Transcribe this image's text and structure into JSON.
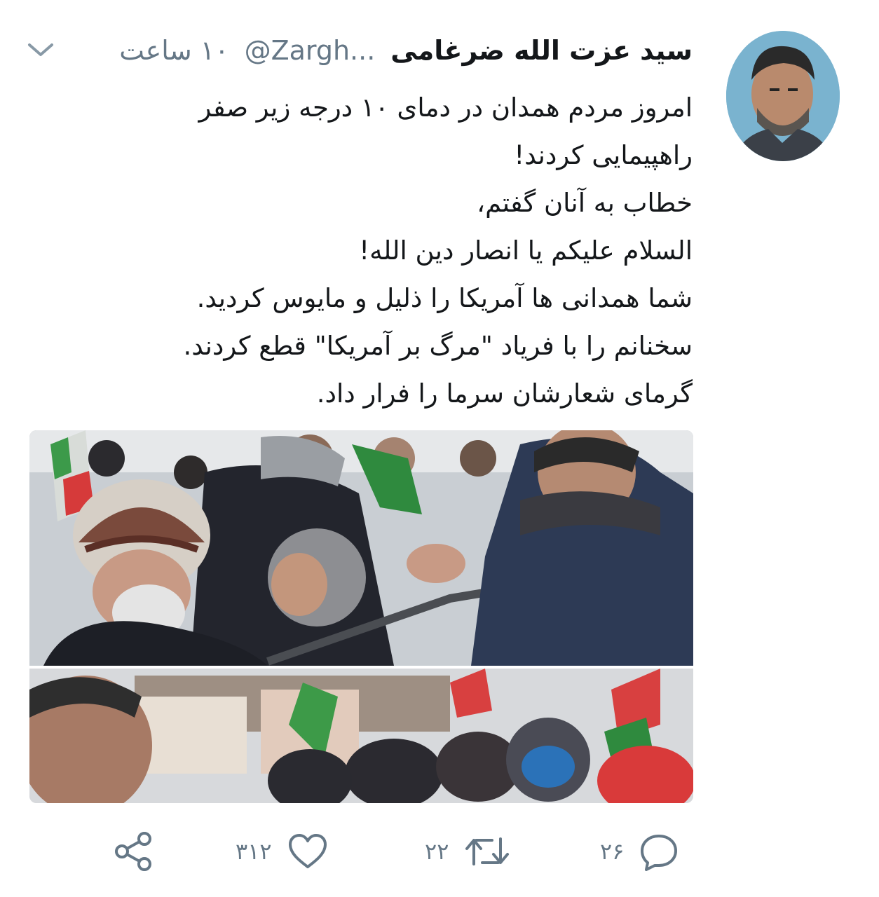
{
  "tweet": {
    "author_name": "سید عزت الله ضرغامی",
    "handle": "@Zargh...",
    "time": "۱۰ ساعت",
    "lines": [
      "امروز مردم همدان در دمای ۱۰ درجه زیر صفر",
      "راهپیمایی کردند!",
      "خطاب به آنان گفتم،",
      "السلام علیکم یا انصار دین الله!",
      "شما همدانی ها آمریکا را ذلیل و مایوس کردید.",
      "سخنانم را با فریاد \"مرگ بر آمریکا\" قطع کردند.",
      "گرمای شعارشان سرما را فرار داد."
    ]
  },
  "actions": {
    "reply_count": "۲۶",
    "retweet_count": "۲۲",
    "like_count": "۳۱۲"
  },
  "colors": {
    "text": "#14171a",
    "secondary": "#657786"
  },
  "icons": [
    "chevron-down-icon",
    "reply-icon",
    "retweet-icon",
    "like-icon",
    "share-icon"
  ]
}
